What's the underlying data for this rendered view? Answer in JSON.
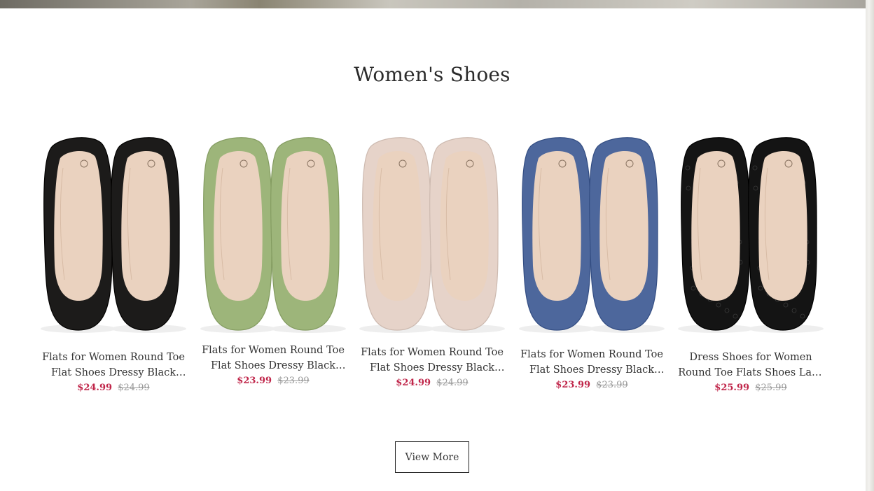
{
  "section": {
    "title": "Women's Shoes"
  },
  "products": [
    {
      "name": "Flats for Women Round Toe Flat Shoes Dressy Black Ballet Flats",
      "price": "$24.99",
      "original_price": "$24.99",
      "color": "#1c1b1a",
      "lace": false
    },
    {
      "name": "Flats for Women Round Toe Flat Shoes Dressy Black Ballet Flats",
      "price": "$23.99",
      "original_price": "$23.99",
      "color": "#9db57a",
      "lace": false
    },
    {
      "name": "Flats for Women Round Toe Flat Shoes Dressy Black Ballet Flats",
      "price": "$24.99",
      "original_price": "$24.99",
      "color": "#e6d3c9",
      "lace": false
    },
    {
      "name": "Flats for Women Round Toe Flat Shoes Dressy Black Ballet Flats",
      "price": "$23.99",
      "original_price": "$23.99",
      "color": "#4d679c",
      "lace": false
    },
    {
      "name": "Dress Shoes for Women Round Toe Flats Shoes Lace Ballet Flats",
      "price": "$25.99",
      "original_price": "$25.99",
      "color": "#141414",
      "lace": true
    }
  ],
  "actions": {
    "view_more": "View More"
  }
}
